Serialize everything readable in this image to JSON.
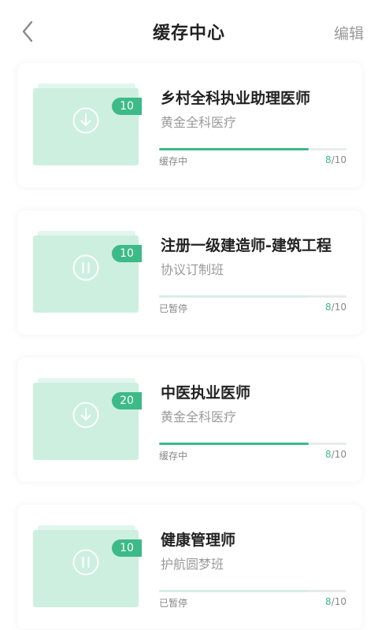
{
  "header": {
    "title": "缓存中心",
    "edit_label": "编辑"
  },
  "colors": {
    "accent": "#3dba88",
    "paused_bar": "#d6efe4",
    "thumb": "#ccefe0"
  },
  "items": [
    {
      "name": "乡村全科执业助理医师",
      "subtitle": "黄金全科医疗",
      "count": "10",
      "state_icon": "download-icon",
      "status": "缓存中",
      "done": "8",
      "total": "/10",
      "progress": 0.8,
      "paused": false
    },
    {
      "name": "注册一级建造师-建筑工程",
      "subtitle": "协议订制班",
      "count": "10",
      "state_icon": "pause-icon",
      "status": "已暂停",
      "done": "8",
      "total": "/10",
      "progress": 0.8,
      "paused": true
    },
    {
      "name": "中医执业医师",
      "subtitle": "黄金全科医疗",
      "count": "20",
      "state_icon": "download-icon",
      "status": "缓存中",
      "done": "8",
      "total": "/10",
      "progress": 0.8,
      "paused": false
    },
    {
      "name": "健康管理师",
      "subtitle": "护航圆梦班",
      "count": "10",
      "state_icon": "pause-icon",
      "status": "已暂停",
      "done": "8",
      "total": "/10",
      "progress": 0.8,
      "paused": true
    }
  ]
}
